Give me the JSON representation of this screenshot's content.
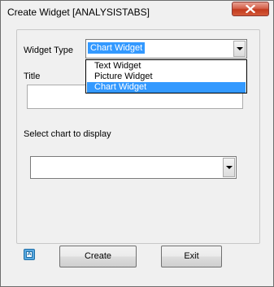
{
  "window": {
    "title": "Create Widget [ANALYSISTABS]"
  },
  "form": {
    "widget_type_label": "Widget Type",
    "widget_type_value": "Chart Widget",
    "widget_type_options": [
      "Text Widget",
      "Picture Widget",
      "Chart Widget"
    ],
    "widget_type_highlighted": "Chart Widget",
    "title_label": "Title",
    "title_value": "",
    "chart_select_label": "Select chart to display",
    "chart_select_value": ""
  },
  "footer": {
    "badge_letter": "A",
    "create_label": "Create",
    "exit_label": "Exit"
  },
  "icons": {
    "close": "close-icon",
    "dropdown": "chevron-down-icon",
    "badge": "analysistabs-logo-icon"
  },
  "colors": {
    "selection": "#3399ff",
    "close_button": "#c8442a",
    "dialog_background": "#f0f0f0"
  }
}
